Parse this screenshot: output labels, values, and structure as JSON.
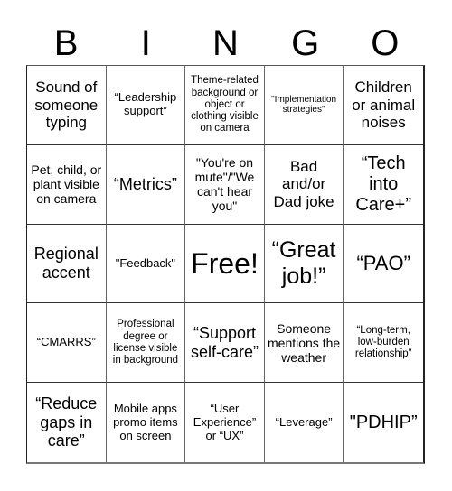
{
  "title_letters": [
    "B",
    "I",
    "N",
    "G",
    "O"
  ],
  "cells": [
    "Sound of someone typing",
    "“Leadership support”",
    "Theme-related background or object or clothing visible on camera",
    "\"Implementation strategies\"",
    "Children or animal noises",
    "Pet, child, or plant visible on camera",
    "“Metrics”",
    "\"You're on mute\"/\"We can't hear you\"",
    "Bad and/or Dad joke",
    "“Tech into Care+”",
    "Regional accent",
    "\"Feedback\"",
    "Free!",
    "“Great job!”",
    "“PAO”",
    "“CMARRS”",
    "Professional degree or license visible in background",
    "“Support self-care”",
    "Someone mentions the weather",
    "“Long-term, low-burden relationship”",
    "“Reduce gaps in care”",
    "Mobile apps promo items on screen",
    "“User Experience” or “UX”",
    "“Leverage”",
    "\"PDHIP”"
  ],
  "free_space_index": 12
}
